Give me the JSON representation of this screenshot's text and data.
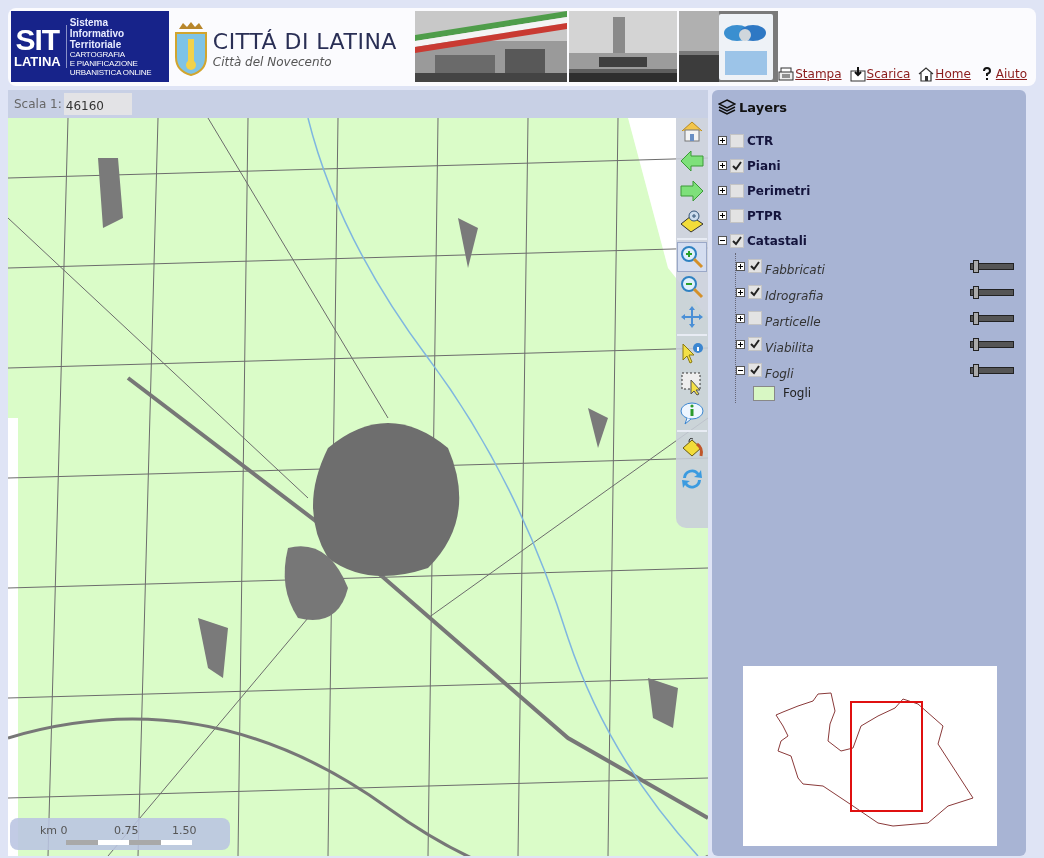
{
  "header": {
    "logo": {
      "title": "SIT",
      "subtitle": "LATINA",
      "lines": [
        "Sistema",
        "Informativo",
        "Territoriale"
      ],
      "tagline": [
        "CARTOGRAFIA",
        "E PIANIFICAZIONE",
        "URBANISTICA ONLINE"
      ]
    },
    "city": {
      "name": "CITTÁ DI LATINA",
      "motto": "Città del Novecento"
    },
    "links": [
      {
        "kind": "print",
        "label": "Stampa"
      },
      {
        "kind": "download",
        "label": "Scarica"
      },
      {
        "kind": "home",
        "label": "Home"
      },
      {
        "kind": "help",
        "label": "Aiuto"
      }
    ]
  },
  "map": {
    "scale_label": "Scala 1:",
    "scale_value": "46160",
    "tool_groups": [
      [
        {
          "kind": "home",
          "selected": false
        },
        {
          "kind": "back",
          "selected": false
        },
        {
          "kind": "forward",
          "selected": false
        },
        {
          "kind": "zoom-extent",
          "selected": false
        }
      ],
      [
        {
          "kind": "zoom-in",
          "selected": true
        },
        {
          "kind": "zoom-out",
          "selected": false
        },
        {
          "kind": "pan",
          "selected": false
        }
      ],
      [
        {
          "kind": "identify",
          "selected": false
        },
        {
          "kind": "select",
          "selected": false
        },
        {
          "kind": "info",
          "selected": false
        }
      ],
      [
        {
          "kind": "clear",
          "selected": false
        },
        {
          "kind": "refresh",
          "selected": false
        }
      ]
    ],
    "scale_bar": {
      "labels": [
        "km 0",
        "0.75",
        "1.50"
      ]
    }
  },
  "layers": {
    "title": "Layers",
    "items": [
      {
        "label": "CTR",
        "checked": false,
        "expanded": false
      },
      {
        "label": "Piani",
        "checked": true,
        "expanded": false
      },
      {
        "label": "Perimetri",
        "checked": false,
        "expanded": false
      },
      {
        "label": "PTPR",
        "checked": false,
        "expanded": false
      },
      {
        "label": "Catastali",
        "checked": true,
        "expanded": true,
        "children": [
          {
            "label": "Fabbricati",
            "checked": true,
            "expanded": false,
            "level": 0.05
          },
          {
            "label": "Idrografia",
            "checked": true,
            "expanded": false,
            "level": 0.05
          },
          {
            "label": "Particelle",
            "checked": false,
            "expanded": false,
            "level": 0.05
          },
          {
            "label": "Viabilita",
            "checked": true,
            "expanded": false,
            "level": 0.05
          },
          {
            "label": "Fogli",
            "checked": true,
            "expanded": true,
            "level": 0.05,
            "legend": [
              {
                "label": "Fogli",
                "color": "#d8f7c4"
              }
            ]
          }
        ]
      }
    ]
  }
}
